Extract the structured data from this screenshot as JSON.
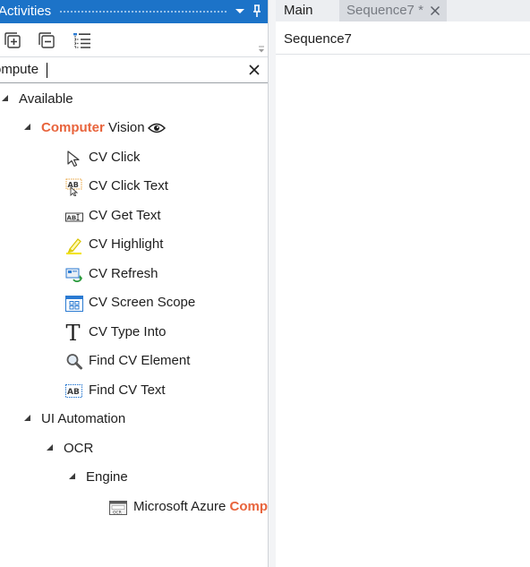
{
  "activities_panel": {
    "title": "Activities",
    "search": {
      "value": "ompute",
      "placeholder": ""
    },
    "toolbar": {
      "expand_all_icon": "expand-all-icon",
      "collapse_all_icon": "collapse-all-icon",
      "show_tree_icon": "tree-list-icon"
    },
    "tree": {
      "available": {
        "label": "Available"
      },
      "computer_vision": {
        "match": "Computer",
        "rest": " Vision",
        "icon": "eye-icon"
      },
      "cv_items": [
        {
          "label": "CV Click",
          "icon": "cursor-icon"
        },
        {
          "label": "CV Click Text",
          "icon": "click-text-icon"
        },
        {
          "label": "CV Get Text",
          "icon": "get-text-icon"
        },
        {
          "label": "CV Highlight",
          "icon": "highlighter-icon"
        },
        {
          "label": "CV Refresh",
          "icon": "refresh-icon"
        },
        {
          "label": "CV Screen Scope",
          "icon": "screen-scope-icon"
        },
        {
          "label": "CV Type Into",
          "icon": "type-into-icon"
        },
        {
          "label": "Find CV Element",
          "icon": "magnifier-icon"
        },
        {
          "label": "Find CV Text",
          "icon": "find-text-icon"
        }
      ],
      "ui_automation": {
        "label": "UI Automation"
      },
      "ocr": {
        "label": "OCR"
      },
      "engine": {
        "label": "Engine"
      },
      "azure": {
        "prefix": "Microsoft Azure ",
        "match": "Comp",
        "icon": "ocr-engine-icon"
      }
    }
  },
  "tabs": [
    {
      "label": "Main"
    },
    {
      "label": "Sequence7 *"
    }
  ],
  "designer": {
    "breadcrumb": "Sequence7"
  },
  "colors": {
    "header_blue": "#1c73c8",
    "match_orange": "#e8643c"
  }
}
